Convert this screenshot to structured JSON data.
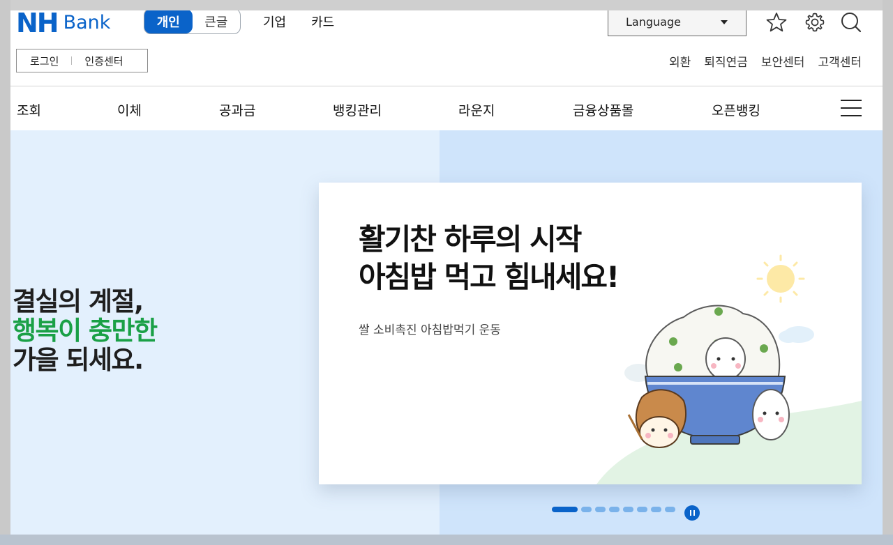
{
  "brand": {
    "nh": "NH",
    "bank": "Bank",
    "color": "#0a63c9"
  },
  "segment": {
    "items": [
      "개인",
      "큰글"
    ],
    "active": 0
  },
  "top_nav": [
    "기업",
    "카드"
  ],
  "language": {
    "label": "Language"
  },
  "header_icons": [
    "star-icon",
    "gear-icon",
    "search-icon"
  ],
  "login": {
    "login_label": "로그인",
    "cert_label": "인증센터"
  },
  "util_nav": [
    "외환",
    "퇴직연금",
    "보안센터",
    "고객센터"
  ],
  "main_nav": [
    "조회",
    "이체",
    "공과금",
    "뱅킹관리",
    "라운지",
    "금융상품몰",
    "오픈뱅킹"
  ],
  "hero": {
    "slogan_line1": "결실의 계절,",
    "slogan_line2": "행복이 충만한",
    "slogan_line3": "가을 되세요.",
    "accent_color": "#1aa046"
  },
  "banner": {
    "title_line1": "활기찬 하루의 시작",
    "title_line2": "아침밥 먹고 힘내세요!",
    "subtitle": "쌀 소비촉진 아침밥먹기 운동"
  },
  "carousel": {
    "total": 8,
    "active": 0,
    "pause_icon": "pause-icon"
  }
}
